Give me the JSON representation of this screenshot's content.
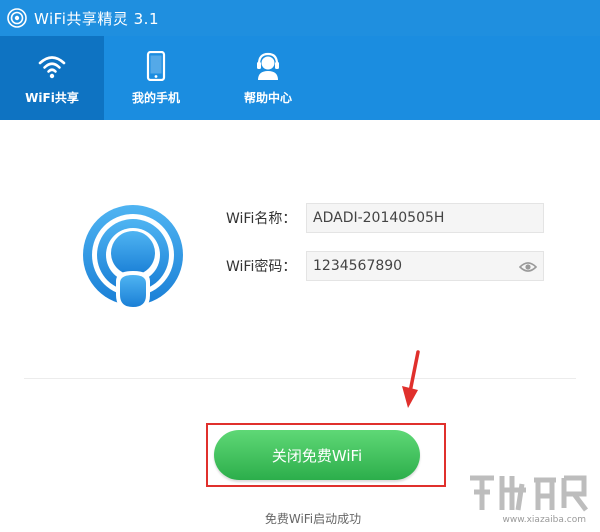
{
  "window": {
    "title": "WiFi共享精灵 3.1",
    "icon": "wifi-app-icon"
  },
  "nav": {
    "tabs": [
      {
        "label": "WiFi共享",
        "icon": "wifi-icon",
        "active": true
      },
      {
        "label": "我的手机",
        "icon": "phone-icon",
        "active": false
      },
      {
        "label": "帮助中心",
        "icon": "headset-icon",
        "active": false
      }
    ]
  },
  "form": {
    "name_label": "WiFi名称：",
    "name_value": "ADADI-20140505H",
    "password_label": "WiFi密码：",
    "password_value": "1234567890"
  },
  "action": {
    "button_label": "关闭免费WiFi"
  },
  "status": {
    "text": "免费WiFi启动成功"
  },
  "watermark": {
    "text": "www.xiazaiba.com"
  },
  "colors": {
    "title_bar": "#1f8fdf",
    "nav_bar": "#1b8de0",
    "nav_active": "#0e73c2",
    "button_green": "#3cc15b",
    "highlight_red": "#e0302c"
  }
}
